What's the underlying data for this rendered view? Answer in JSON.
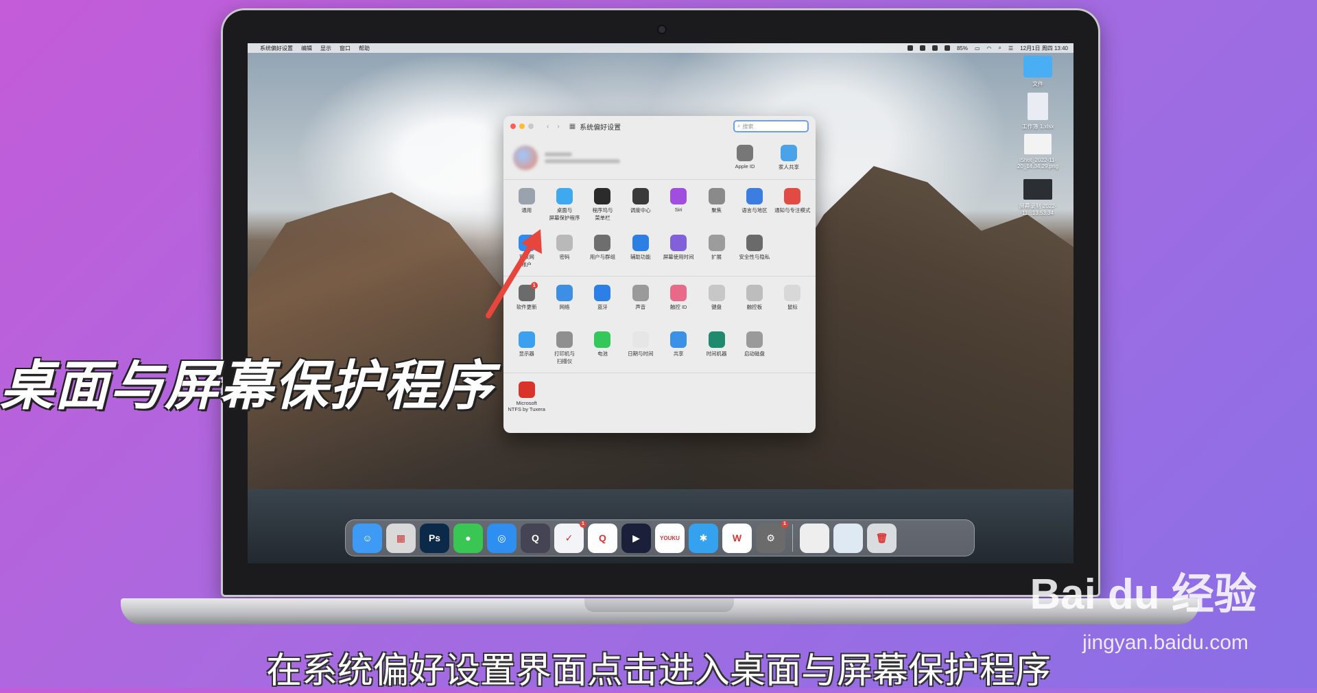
{
  "menubar": {
    "app_name": "系统偏好设置",
    "menus": [
      "编辑",
      "显示",
      "窗口",
      "帮助"
    ],
    "battery": "85%",
    "datetime": "12月1日 周四 13:40"
  },
  "desktop": {
    "items": [
      {
        "label": "文件"
      },
      {
        "label": "工作簿 1.xlsx"
      },
      {
        "label": "iShot_2022-11-20_14.34.29.png"
      },
      {
        "label": "屏幕录制 2022-11...13.53.34"
      }
    ]
  },
  "window": {
    "title": "系统偏好设置",
    "search_placeholder": "搜索",
    "top_icons": [
      {
        "label": "Apple ID",
        "icon": "apple-id-icon",
        "color": "#777777"
      },
      {
        "label": "家人共享",
        "icon": "family-sharing-icon",
        "color": "#4aa3e8"
      }
    ],
    "row1": [
      {
        "label": "通用",
        "icon": "general-icon",
        "color": "#9aa3ad"
      },
      {
        "label": "桌面与\n屏幕保护程序",
        "icon": "desktop-screensaver-icon",
        "color": "#3fa9f0"
      },
      {
        "label": "程序坞与\n菜单栏",
        "icon": "dock-menubar-icon",
        "color": "#2b2b2b"
      },
      {
        "label": "调度中心",
        "icon": "mission-control-icon",
        "color": "#3a3a3a"
      },
      {
        "label": "Siri",
        "icon": "siri-icon",
        "color": "#a04ee0"
      },
      {
        "label": "聚焦",
        "icon": "spotlight-icon",
        "color": "#8a8a8a"
      },
      {
        "label": "语言与地区",
        "icon": "language-region-icon",
        "color": "#3b7ee0"
      },
      {
        "label": "通知与专注模式",
        "icon": "notifications-icon",
        "color": "#e24b44"
      }
    ],
    "row2": [
      {
        "label": "互联网\n帐户",
        "icon": "internet-accounts-icon",
        "color": "#2e8cf0"
      },
      {
        "label": "密码",
        "icon": "passwords-icon",
        "color": "#b9b9b9"
      },
      {
        "label": "用户与群组",
        "icon": "users-groups-icon",
        "color": "#6e6e6e"
      },
      {
        "label": "辅助功能",
        "icon": "accessibility-icon",
        "color": "#2d7fe3"
      },
      {
        "label": "屏幕使用时间",
        "icon": "screen-time-icon",
        "color": "#8160d9"
      },
      {
        "label": "扩展",
        "icon": "extensions-icon",
        "color": "#9c9c9c"
      },
      {
        "label": "安全性与隐私",
        "icon": "security-privacy-icon",
        "color": "#6a6a6a"
      }
    ],
    "row3": [
      {
        "label": "软件更新",
        "icon": "software-update-icon",
        "color": "#6b6b6b",
        "badge": "1"
      },
      {
        "label": "网络",
        "icon": "network-icon",
        "color": "#3d8fe6"
      },
      {
        "label": "蓝牙",
        "icon": "bluetooth-icon",
        "color": "#2b7fe6"
      },
      {
        "label": "声音",
        "icon": "sound-icon",
        "color": "#9a9a9a"
      },
      {
        "label": "触控 ID",
        "icon": "touch-id-icon",
        "color": "#e86a88"
      },
      {
        "label": "键盘",
        "icon": "keyboard-icon",
        "color": "#c7c7c7"
      },
      {
        "label": "触控板",
        "icon": "trackpad-icon",
        "color": "#bdbdbd"
      },
      {
        "label": "鼠标",
        "icon": "mouse-icon",
        "color": "#d8d8d8"
      }
    ],
    "row4": [
      {
        "label": "显示器",
        "icon": "displays-icon",
        "color": "#3ba0f0"
      },
      {
        "label": "打印机与\n扫描仪",
        "icon": "printers-icon",
        "color": "#8f8f8f"
      },
      {
        "label": "电池",
        "icon": "battery-icon",
        "color": "#34c759"
      },
      {
        "label": "日期与时间",
        "icon": "date-time-icon",
        "color": "#e6e6e6"
      },
      {
        "label": "共享",
        "icon": "sharing-icon",
        "color": "#3a91e6"
      },
      {
        "label": "时间机器",
        "icon": "time-machine-icon",
        "color": "#1e8b6e"
      },
      {
        "label": "启动磁盘",
        "icon": "startup-disk-icon",
        "color": "#9a9a9a"
      }
    ],
    "row5": [
      {
        "label": "Microsoft\nNTFS by Tuxera",
        "icon": "ntfs-tuxera-icon",
        "color": "#d9342b"
      }
    ]
  },
  "dock": {
    "apps": [
      {
        "name": "finder-icon",
        "color": "#3e9bf5",
        "glyph": "☺"
      },
      {
        "name": "launchpad-icon",
        "color": "#d9d9d9",
        "glyph": "▦"
      },
      {
        "name": "photoshop-icon",
        "color": "#0b2a4a",
        "glyph": "Ps"
      },
      {
        "name": "messages-icon",
        "color": "#39c653",
        "glyph": "●"
      },
      {
        "name": "safari-icon",
        "color": "#2f8ff0",
        "glyph": "◎"
      },
      {
        "name": "quicktime-icon",
        "color": "#445",
        "glyph": "Q"
      },
      {
        "name": "dingtalk-icon",
        "color": "#f2f4f8",
        "glyph": "✓",
        "badge": "1"
      },
      {
        "name": "qq-icon",
        "color": "#ffffff",
        "glyph": "Q"
      },
      {
        "name": "video-player-icon",
        "color": "#1b1f3a",
        "glyph": "▶"
      },
      {
        "name": "youku-icon",
        "color": "#ffffff",
        "glyph": "YOUKU"
      },
      {
        "name": "crab-app-icon",
        "color": "#35a2ef",
        "glyph": "✱"
      },
      {
        "name": "wps-icon",
        "color": "#ffffff",
        "glyph": "W"
      },
      {
        "name": "system-preferences-icon",
        "color": "#6b6b6b",
        "glyph": "⚙",
        "badge": "1"
      },
      {
        "name": "recent-window-icon",
        "color": "#eeeeee",
        "glyph": ""
      },
      {
        "name": "recent-window-icon-2",
        "color": "#dfe9f3",
        "glyph": ""
      },
      {
        "name": "trash-icon",
        "color": "#d9dde0",
        "glyph": "🗑"
      }
    ]
  },
  "overlay": {
    "big_caption": "桌面与屏幕保护程序",
    "subtitle": "在系统偏好设置界面点击进入桌面与屏幕保护程序",
    "watermark": "Bai du 经验",
    "watermark_url": "jingyan.baidu.com"
  }
}
